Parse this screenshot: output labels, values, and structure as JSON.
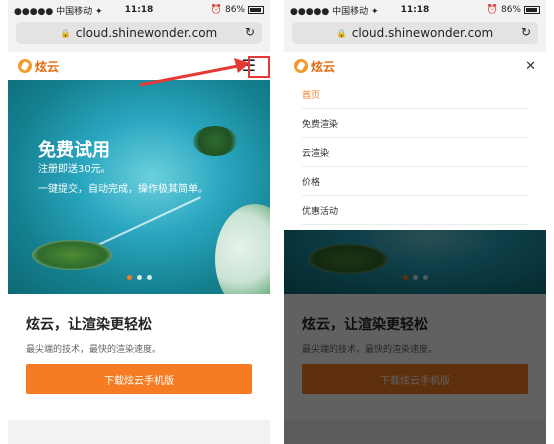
{
  "status": {
    "signal": "●●●●● 中国移动 ✦",
    "time": "11:18",
    "battery": "86%"
  },
  "browser": {
    "url": "cloud.shinewonder.com"
  },
  "site": {
    "logo": "炫云",
    "hero": {
      "title": "免费试用",
      "line1": "注册即送30元。",
      "line2": "一键提交，自动完成，操作极其简单。"
    },
    "card": {
      "title": "炫云，让渲染更轻松",
      "desc": "最尖端的技术，最快的渲染速度。",
      "download": "下载炫云手机版"
    }
  },
  "menu": {
    "items": [
      {
        "label": "首页"
      },
      {
        "label": "免费渲染"
      },
      {
        "label": "云渲染"
      },
      {
        "label": "价格"
      },
      {
        "label": "优惠活动"
      }
    ]
  },
  "icons": {
    "hamburger": "hamburger-icon",
    "close": "close-icon",
    "lock": "lock-icon",
    "reload": "reload-icon"
  },
  "colors": {
    "accent": "#f57c22",
    "highlight": "#e53935"
  }
}
